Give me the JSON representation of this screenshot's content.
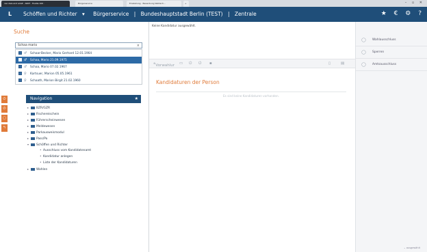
{
  "browser": {
    "tabs": [
      {
        "label": "ceo dais and adult · AKKT · Hustle 100 ·"
      },
      {
        "label": "Bürgerservice"
      },
      {
        "label": "Einstellung · Bewerbung Wahlsch…"
      },
      {
        "label": "+"
      }
    ],
    "window_controls": "– ▫ ✕"
  },
  "appbar": {
    "logo": "L",
    "crumb_1": "Schöffen und Richter",
    "crumb_1_caret": "▾",
    "crumb_2": "Bürgerservice",
    "crumb_sep": "|",
    "crumb_3": "Bundeshauptstadt Berlin (TEST)",
    "crumb_4": "Zentrale",
    "icon_star": "★",
    "icon_euro": "€",
    "icon_gear": "⚙",
    "icon_help": "?"
  },
  "search": {
    "title": "Suche",
    "value": "Schaa mario",
    "clear": "×",
    "results": [
      {
        "gender": "♂",
        "text": "Schaar-Becker, Mario Gerhard 12.01.1964",
        "selected": false
      },
      {
        "gender": "♂",
        "text": "Schaa, Mario 21.09.1975",
        "selected": true
      },
      {
        "gender": "♂",
        "text": "Schaa, Mario 07.02.1967",
        "selected": false
      },
      {
        "gender": "♀",
        "text": "Kartsuer, Marion 05.05.1961",
        "selected": false
      },
      {
        "gender": "♀",
        "text": "Schaath, Marion Birgit 21.02.1960",
        "selected": false
      }
    ]
  },
  "navigation": {
    "title": "Navigation",
    "star": "★",
    "items": [
      {
        "label": "BZR/GZR",
        "sub": false
      },
      {
        "label": "Fischereischein",
        "sub": false
      },
      {
        "label": "Führerscheinwesen",
        "sub": false
      },
      {
        "label": "Meldewesen",
        "sub": false
      },
      {
        "label": "Parkausweismodul",
        "sub": false
      },
      {
        "label": "Pass/Pa",
        "sub": false
      },
      {
        "label": "Schöffen und Richter",
        "sub": false,
        "open": true
      },
      {
        "label": "Ausschluss vom Kandidatenamt",
        "sub": true
      },
      {
        "label": "Kandidatur anlegen",
        "sub": true
      },
      {
        "label": "Liste der Kandidaturen",
        "sub": true
      },
      {
        "label": "Wahlen",
        "sub": false
      }
    ]
  },
  "center": {
    "info": "Keine Kandidatur ausgewählt.",
    "toolbar_first": "Vorwahlur",
    "section_title": "Kandidaturen der Person",
    "empty_text": "Es sind keine Kandidaturen vorhanden."
  },
  "right": {
    "actions": [
      {
        "label": "Wahlausschluss"
      },
      {
        "label": "Sperren"
      },
      {
        "label": "Amtsausschluss"
      }
    ]
  },
  "status": {
    "text": "⌄ ausgewählt"
  },
  "colors": {
    "header": "#1f4e79",
    "accent": "#e07b3a",
    "selection": "#2d6aa6"
  }
}
